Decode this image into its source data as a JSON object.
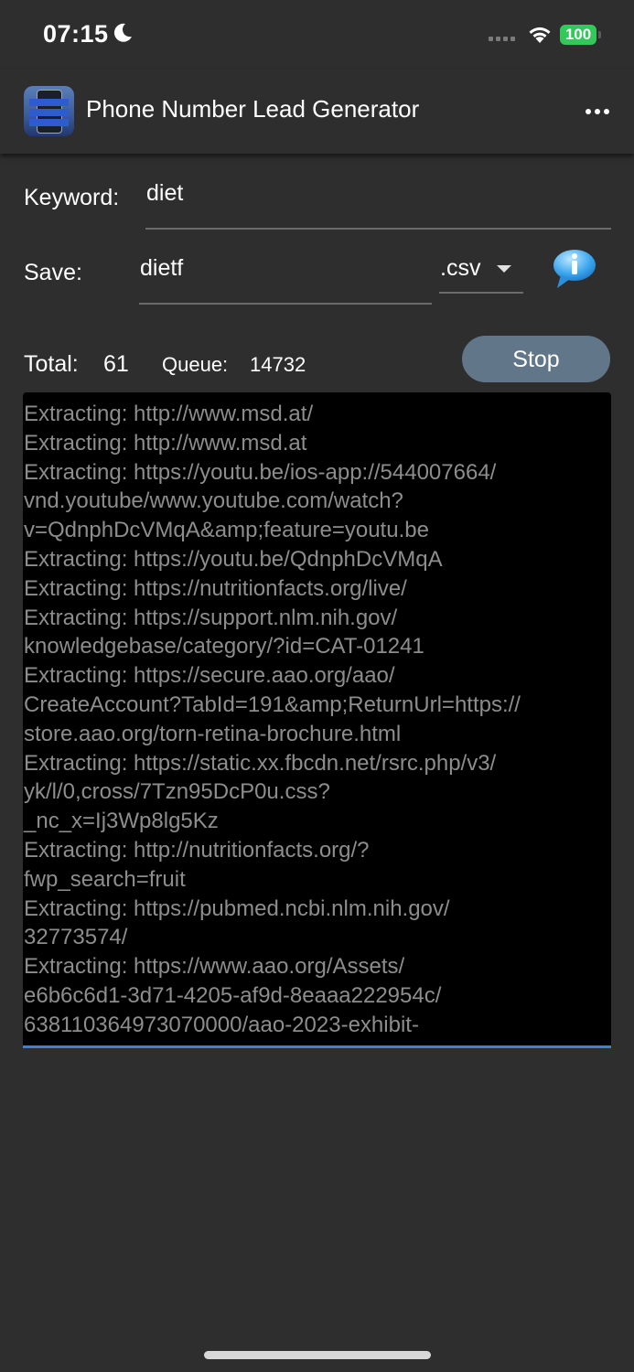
{
  "status_bar": {
    "time": "07:15",
    "battery": "100",
    "icons": [
      "moon-icon",
      "cellular-signal-icon",
      "wifi-icon",
      "battery-icon"
    ]
  },
  "app_bar": {
    "title": "Phone Number Lead Generator",
    "icons": [
      "app-icon",
      "more-icon"
    ]
  },
  "form": {
    "keyword_label": "Keyword:",
    "keyword_value": "diet",
    "save_label": "Save:",
    "save_value": "dietf",
    "format_value": ".csv",
    "icons": [
      "dropdown-arrow-icon",
      "info-icon"
    ]
  },
  "counters": {
    "total_label": "Total:",
    "total_value": "61",
    "queue_label": "Queue:",
    "queue_value": "14732",
    "stop_label": "Stop"
  },
  "log": {
    "lines": [
      "Extracting: http://www.msd.at/",
      "Extracting: http://www.msd.at",
      "Extracting: https://youtu.be/ios-app://544007664/",
      "vnd.youtube/www.youtube.com/watch?",
      "v=QdnphDcVMqA&amp;feature=youtu.be",
      "Extracting: https://youtu.be/QdnphDcVMqA",
      "Extracting: https://nutritionfacts.org/live/",
      "Extracting: https://support.nlm.nih.gov/",
      "knowledgebase/category/?id=CAT-01241",
      "Extracting: https://secure.aao.org/aao/",
      "CreateAccount?TabId=191&amp;ReturnUrl=https://",
      "store.aao.org/torn-retina-brochure.html",
      "Extracting: https://static.xx.fbcdn.net/rsrc.php/v3/",
      "yk/l/0,cross/7Tzn95DcP0u.css?",
      "_nc_x=Ij3Wp8lg5Kz",
      "Extracting: http://nutritionfacts.org/?",
      "fwp_search=fruit",
      "Extracting: https://pubmed.ncbi.nlm.nih.gov/",
      "32773574/",
      "Extracting: https://www.aao.org/Assets/",
      "e6b6c6d1-3d71-4205-af9d-8eaaa222954c/",
      "638110364973070000/aao-2023-exhibit-"
    ]
  }
}
